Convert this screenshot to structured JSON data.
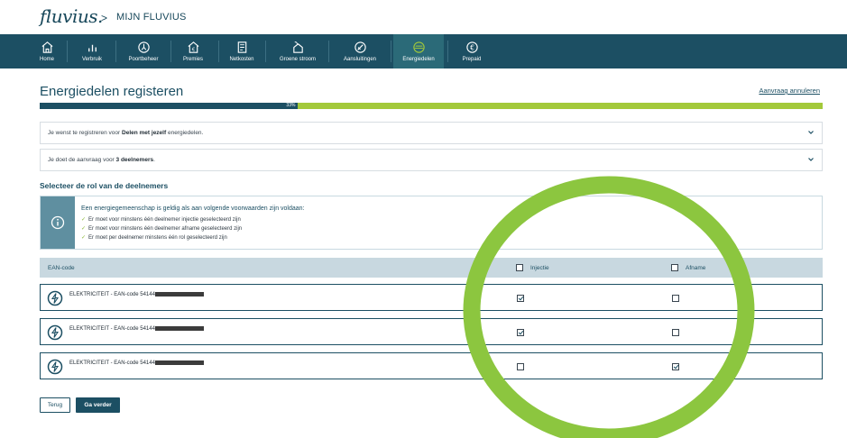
{
  "header": {
    "logo": "fluvius.",
    "breadcrumb_sep": ">",
    "breadcrumb": "MIJN FLUVIUS"
  },
  "nav": {
    "items": [
      {
        "label": "Home",
        "icon": "home-icon"
      },
      {
        "label": "Verbruik",
        "icon": "bar-chart-icon"
      },
      {
        "label": "Poortbeheer",
        "icon": "gate-icon"
      },
      {
        "label": "Premies",
        "icon": "house-euro-icon"
      },
      {
        "label": "Netkosten",
        "icon": "invoice-icon"
      },
      {
        "label": "Groene stroom",
        "icon": "green-power-icon"
      },
      {
        "label": "Aansluitingen",
        "icon": "connection-icon"
      },
      {
        "label": "Energiedelen",
        "icon": "energy-sharing-icon"
      },
      {
        "label": "Prepaid",
        "icon": "euro-icon"
      }
    ],
    "active": "Energiedelen"
  },
  "page": {
    "title": "Energiedelen registeren",
    "cancel_link": "Aanvraag annuleren"
  },
  "progress": {
    "label": "33%",
    "value": 0.33
  },
  "accordions": [
    {
      "prefix": "Je wenst te registreren voor ",
      "bold": "Delen met jezelf",
      "suffix": " energiedelen."
    },
    {
      "prefix": "Je doet de aanvraag voor ",
      "bold": "3 deelnemers",
      "suffix": "."
    }
  ],
  "section_title": "Selecteer de rol van de deelnemers",
  "info": {
    "heading": "Een energiegemeenschap is geldig als aan volgende voorwaarden zijn voldaan:",
    "lines": [
      "Er moet voor minstens één deelnemer injectie geselecteerd zijn",
      "Er moet voor minstens één deelnemer afname geselecteerd zijn",
      "Er moet per deelnemer minstens één rol geselecteerd zijn"
    ]
  },
  "table": {
    "col_ean": "EAN-code",
    "col_injectie": "Injectie",
    "col_afname": "Afname",
    "rows": [
      {
        "label": "ELEKTRICITEIT - EAN-code 54144",
        "injectie": true,
        "afname": false
      },
      {
        "label": "ELEKTRICITEIT - EAN-code 54144",
        "injectie": true,
        "afname": false
      },
      {
        "label": "ELEKTRICITEIT - EAN-code 54144",
        "injectie": false,
        "afname": true
      }
    ]
  },
  "buttons": {
    "back": "Terug",
    "next": "Ga verder"
  },
  "colors": {
    "brand": "#1c4f63",
    "accent": "#a3c93a",
    "highlight_circle": "#8cc63f"
  }
}
